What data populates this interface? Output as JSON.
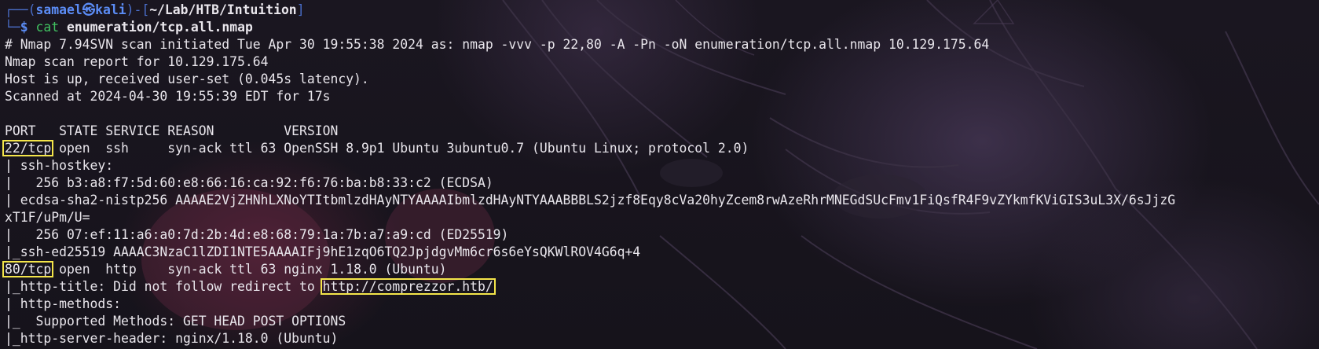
{
  "prompt": {
    "frame_top": "┌──(",
    "user": "samael",
    "at_symbol": "㉿",
    "host": "kali",
    "mid_bracket": ")-[",
    "path": "~/Lab/HTB/Intuition",
    "end_bracket": "]",
    "frame_bottom": "└─",
    "dollar": "$",
    "command": "cat",
    "argument": "enumeration/tcp.all.nmap"
  },
  "output": {
    "line_header": "# Nmap 7.94SVN scan initiated Tue Apr 30 19:55:38 2024 as: nmap -vvv -p 22,80 -A -Pn -oN enumeration/tcp.all.nmap 10.129.175.64",
    "line_report": "Nmap scan report for 10.129.175.64",
    "line_hostup": "Host is up, received user-set (0.045s latency).",
    "line_scanned": "Scanned at 2024-04-30 19:55:39 EDT for 17s",
    "line_blank": "",
    "line_columns": "PORT   STATE SERVICE REASON         VERSION",
    "port_22": "22/tcp",
    "port_22_rest": " open  ssh     syn-ack ttl 63 OpenSSH 8.9p1 Ubuntu 3ubuntu0.7 (Ubuntu Linux; protocol 2.0)",
    "line_hostkey": "| ssh-hostkey: ",
    "line_ecdsa_fp": "|   256 b3:a8:f7:5d:60:e8:66:16:ca:92:f6:76:ba:b8:33:c2 (ECDSA)",
    "line_ecdsa_key1": "| ecdsa-sha2-nistp256 AAAAE2VjZHNhLXNoYTItbmlzdHAyNTYAAAAIbmlzdHAyNTYAAABBBLS2jzf8Eqy8cVa20hyZcem8rwAzeRhrMNEGdSUcFmv1FiQsfR4F9vZYkmfKViGIS3uL3X/6sJjzG",
    "line_ecdsa_key2": "xT1F/uPm/U=",
    "line_ed_fp": "|   256 07:ef:11:a6:a0:7d:2b:4d:e8:68:79:1a:7b:a7:a9:cd (ED25519)",
    "line_ed_key": "|_ssh-ed25519 AAAAC3NzaC1lZDI1NTE5AAAAIFj9hE1zqO6TQ2JpjdgvMm6cr6s6eYsQKWlROV4G6q+4",
    "port_80": "80/tcp",
    "port_80_rest": " open  http    syn-ack ttl 63 nginx 1.18.0 (Ubuntu)",
    "http_title_prefix": "|_http-title: Did not follow redirect to ",
    "http_title_url": "http://comprezzor.htb/",
    "line_methods": "| http-methods: ",
    "line_supported": "|_  Supported Methods: GET HEAD POST OPTIONS",
    "line_server": "|_http-server-header: nginx/1.18.0 (Ubuntu)"
  },
  "colors": {
    "prompt_blue": "#5b8cf5",
    "frame_blue": "#4a6ec9",
    "command_green": "#40c060",
    "text": "#e9e6ec",
    "highlight_box": "#f4e54a",
    "background": "#15121a"
  }
}
